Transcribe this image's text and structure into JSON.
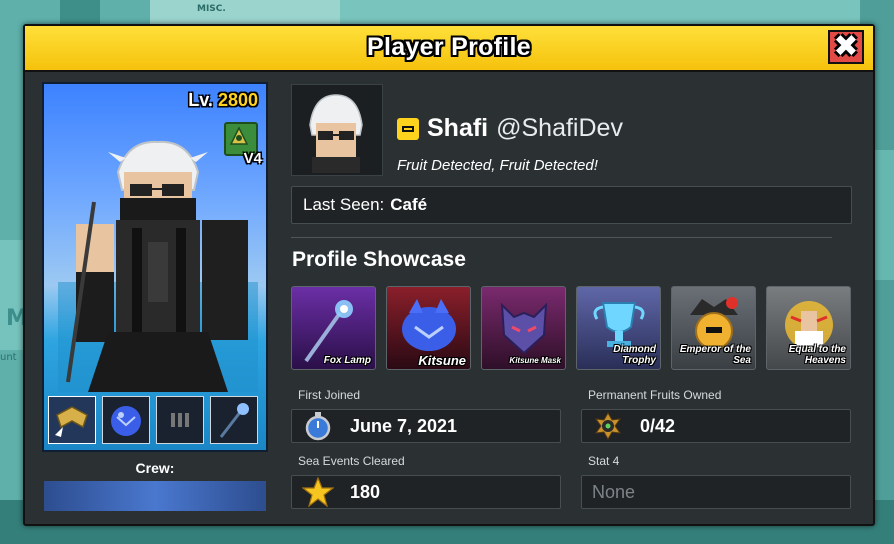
{
  "background": {
    "misc_label": "MISC.",
    "sign_letter": "M",
    "sign_sub": "unt"
  },
  "window": {
    "title": "Player Profile",
    "close_glyph": "✖"
  },
  "avatar": {
    "level_prefix": "Lv.",
    "level": "2800",
    "race_version": "V4",
    "equipped": [
      {
        "name": "wings-emblem",
        "selected": true
      },
      {
        "name": "kitsune-fruit",
        "selected": false
      },
      {
        "name": "bullets",
        "selected": false
      },
      {
        "name": "fox-lamp",
        "selected": false
      }
    ],
    "crew_label": "Crew:"
  },
  "profile": {
    "display_name": "Shafi",
    "username": "@ShafiDev",
    "status": "Fruit Detected, Fruit Detected!",
    "last_seen_label": "Last Seen:",
    "last_seen_value": "Café"
  },
  "showcase": {
    "title": "Profile Showcase",
    "items": [
      {
        "label": "Fox Lamp",
        "color": "#4a1c7a"
      },
      {
        "label": "Kitsune",
        "color": "#3a1224"
      },
      {
        "label": "Kitsune Mask",
        "color": "#3d1836"
      },
      {
        "label": "Diamond Trophy",
        "color": "#3a3f6e"
      },
      {
        "label": "Emperor of the Sea",
        "color": "#4d5257"
      },
      {
        "label": "Equal to the Heavens",
        "color": "#5a5d61"
      }
    ]
  },
  "stats": {
    "first_joined_label": "First Joined",
    "first_joined_value": "June 7, 2021",
    "permanent_fruits_label": "Permanent Fruits Owned",
    "permanent_fruits_value": "0/42",
    "sea_events_label": "Sea Events Cleared",
    "sea_events_value": "180",
    "stat4_label": "Stat 4",
    "stat4_value": "None"
  },
  "colors": {
    "title_bar": "#f5c20c",
    "close_button": "#e24a45",
    "level_number": "#ffd21e",
    "panel": "#2b3133"
  }
}
